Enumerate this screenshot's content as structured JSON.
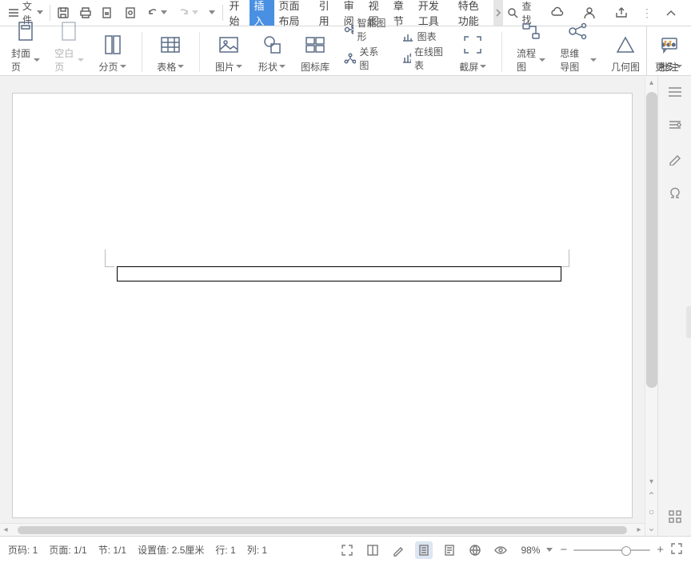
{
  "menubar": {
    "menu_label": "文件",
    "tabs": [
      "开始",
      "插入",
      "页面布局",
      "引用",
      "审阅",
      "视图",
      "章节",
      "开发工具",
      "特色功能"
    ],
    "active_tab_index": 1,
    "find_label": "查找"
  },
  "ribbon": {
    "cover": "封面页",
    "blank": "空白页",
    "page_break": "分页",
    "table": "表格",
    "picture": "图片",
    "shape": "形状",
    "icon_lib": "图标库",
    "smart_art": "智能图形",
    "chart": "图表",
    "relation": "关系图",
    "online_chart": "在线图表",
    "screenshot": "截屏",
    "flowchart": "流程图",
    "mindmap": "思维导图",
    "geometry": "几何图",
    "more": "更多",
    "annotate": "批注"
  },
  "statusbar": {
    "page_no": "页码: 1",
    "page_of": "页面: 1/1",
    "section": "节: 1/1",
    "indent": "设置值: 2.5厘米",
    "row": "行: 1",
    "col": "列: 1",
    "zoom": "98%"
  }
}
